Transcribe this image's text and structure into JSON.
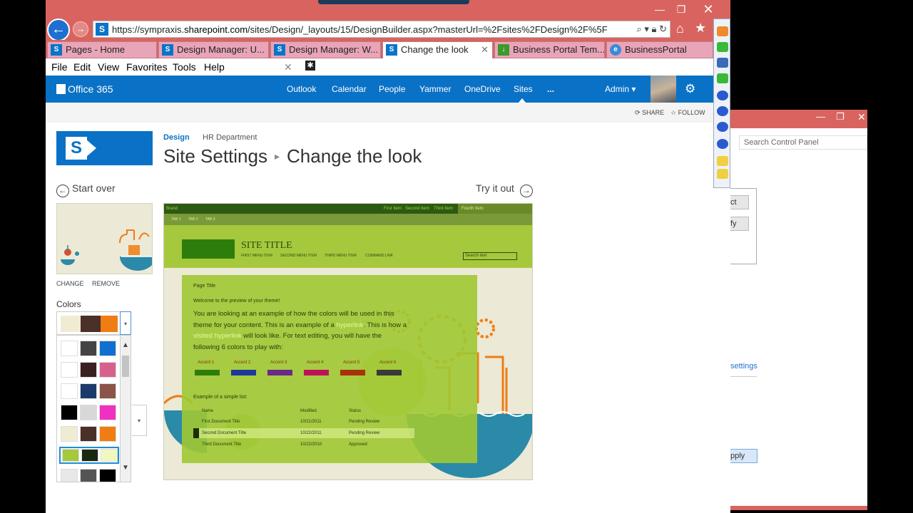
{
  "browser": {
    "url_prefix": "https://sympraxis.",
    "url_domain": "sharepoint.com",
    "url_rest": "/sites/Design/_layouts/15/DesignBuilder.aspx?masterUrl=%2Fsites%2FDesign%2F%5F",
    "tabs": [
      {
        "label": "Pages - Home"
      },
      {
        "label": "Design Manager: U..."
      },
      {
        "label": "Design Manager: W..."
      },
      {
        "label": "Change the look"
      },
      {
        "label": "Business Portal Tem..."
      },
      {
        "label": "BusinessPortal"
      }
    ],
    "menu": [
      "File",
      "Edit",
      "View",
      "Favorites",
      "Tools",
      "Help"
    ]
  },
  "suitebar": {
    "brand": "Office 365",
    "links": [
      "Outlook",
      "Calendar",
      "People",
      "Yammer",
      "OneDrive",
      "Sites",
      "..."
    ],
    "user": "Admin"
  },
  "actions": {
    "share": "SHARE",
    "follow": "FOLLOW"
  },
  "breadcrumb": {
    "site": "Design",
    "sub": "HR Department"
  },
  "title": {
    "parent": "Site Settings",
    "current": "Change the look"
  },
  "nav": {
    "start_over": "Start over",
    "try_it_out": "Try it out"
  },
  "thumb_links": {
    "change": "CHANGE",
    "remove": "REMOVE"
  },
  "colors_label": "Colors",
  "color_selected": [
    "#f0ecd4",
    "#4a3028",
    "#ef7d14"
  ],
  "color_options": [
    [
      "#ffffff",
      "#444444",
      "#1070d0"
    ],
    [
      "#ffffff",
      "#3a2020",
      "#d8608c"
    ],
    [
      "#ffffff",
      "#1c3a6a",
      "#8a5448"
    ],
    [
      "#000000",
      "#d8d8d8",
      "#f030c0"
    ],
    [
      "#f0ecd4",
      "#4a3028",
      "#ef7d14"
    ],
    [
      "#a6c83c",
      "#1a2a10",
      "#f0f8c0"
    ],
    [
      "#e8e8e8",
      "#555555",
      "#000000"
    ]
  ],
  "preview": {
    "brand": "Brand",
    "top_nav": [
      "First Item",
      "Second Item",
      "Third Item",
      "Fourth Item"
    ],
    "tabs": [
      "TAB 1",
      "TAB 2",
      "TAB 3"
    ],
    "site_title": "SITE TITLE",
    "menu": [
      "FIRST MENU ITEM",
      "SECOND MENU ITEM",
      "THIRD MENU ITEM",
      "COMMAND LINK"
    ],
    "search": "Search text",
    "page_title": "Page Title",
    "welcome": "Welcome to the preview of your theme!",
    "para_1": "You are looking at an example of how the colors will be used in this theme for your content. This is an example of a ",
    "hyperlink": "hyperlink",
    "para_2": ". This is how a ",
    "visited": "visited hyperlink",
    "para_3": " will look like. For text editing, you will have the following 6 colors to play with:",
    "accents": [
      {
        "label": "Accent 1",
        "color": "#2d7d0c"
      },
      {
        "label": "Accent 2",
        "color": "#1c3a9a"
      },
      {
        "label": "Accent 3",
        "color": "#6a2a8a"
      },
      {
        "label": "Accent 4",
        "color": "#c0105a"
      },
      {
        "label": "Accent 5",
        "color": "#a8300a"
      },
      {
        "label": "Accent 6",
        "color": "#3a3a3a"
      }
    ],
    "list_title": "Example of a simple list:",
    "columns": [
      "Name",
      "Modified",
      "Status"
    ],
    "rows": [
      [
        "First Document Title",
        "10/21/2011",
        "Pending Review"
      ],
      [
        "Second Document Title",
        "10/22/2011",
        "Pending Review"
      ],
      [
        "Third Document Title",
        "10/22/2010",
        "Approved"
      ]
    ]
  },
  "control_panel": {
    "search_placeholder": "Search Control Panel",
    "btn1": "ct",
    "btn2": "fy",
    "link": "settings",
    "apply": "pply"
  }
}
